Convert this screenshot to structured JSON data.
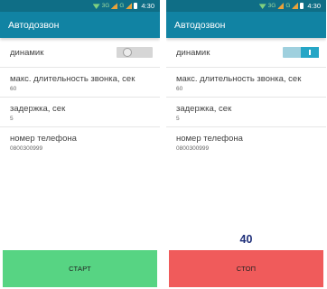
{
  "status_bar": {
    "network": "3G",
    "carrier_mark": "G",
    "time": "4:30"
  },
  "app": {
    "title": "Автодозвон"
  },
  "settings": {
    "speaker_label": "динамик",
    "max_duration_label": "макс. длительность звонка, сек",
    "max_duration_value": "60",
    "delay_label": "задержка, сек",
    "delay_value": "5",
    "phone_label": "номер телефона",
    "phone_value": "0800300999"
  },
  "left_screen": {
    "speaker_on": false,
    "button_label": "СТАРТ",
    "button_color": "#57d483"
  },
  "right_screen": {
    "speaker_on": true,
    "timer_value": "40",
    "button_label": "СТОП",
    "button_color": "#f05b5b"
  },
  "colors": {
    "status_bar": "#0f6e86",
    "app_bar": "#1183a3",
    "timer_text": "#1f2f7a"
  }
}
